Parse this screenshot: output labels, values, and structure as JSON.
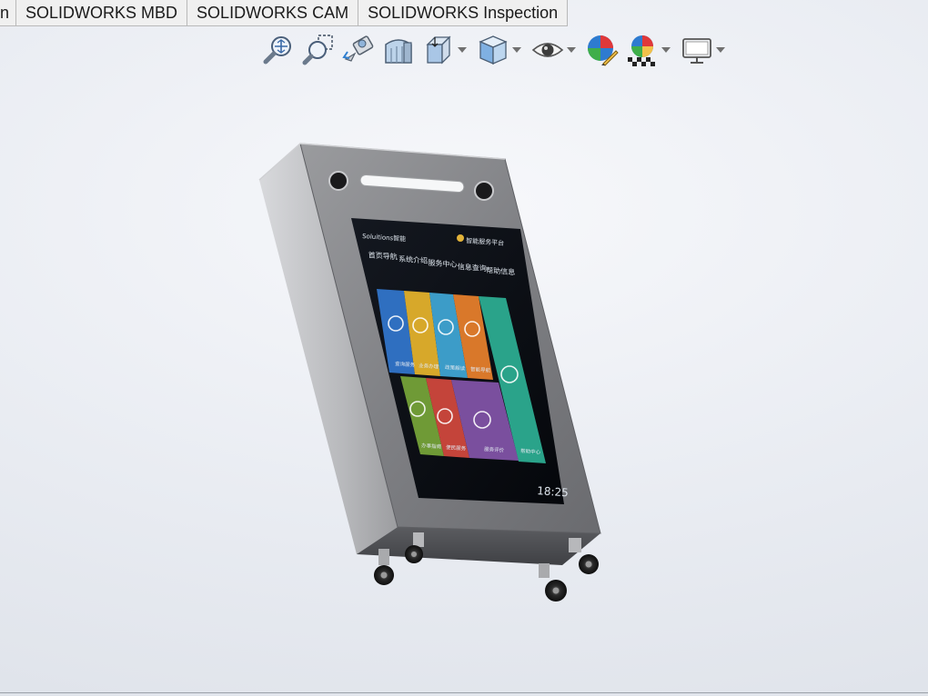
{
  "tabs": [
    {
      "label": "n"
    },
    {
      "label": "SOLIDWORKS MBD"
    },
    {
      "label": "SOLIDWORKS CAM"
    },
    {
      "label": "SOLIDWORKS Inspection"
    }
  ],
  "hud_toolbar": [
    {
      "name": "zoom-to-fit-icon"
    },
    {
      "name": "zoom-to-area-icon"
    },
    {
      "name": "previous-view-icon"
    },
    {
      "name": "section-view-icon"
    },
    {
      "name": "view-orientation-icon",
      "dropdown": true
    },
    {
      "name": "display-style-icon",
      "dropdown": true
    },
    {
      "name": "hide-show-items-icon",
      "dropdown": true
    },
    {
      "name": "edit-appearance-icon"
    },
    {
      "name": "apply-scene-icon",
      "dropdown": true
    },
    {
      "name": "view-settings-icon",
      "dropdown": true
    }
  ],
  "model": {
    "screen_header_left": "Soluitions智能",
    "screen_header_right": "智能服务平台",
    "menu": [
      "首页导航",
      "系统介绍",
      "服务中心",
      "信息查询",
      "帮助信息"
    ],
    "tiles": [
      "查询服务",
      "业务办理",
      "政策解读",
      "智能导航",
      "帮助中心",
      "办事指南",
      "便民服务",
      "服务评价"
    ],
    "clock": "18:25"
  },
  "colors": {
    "tab_bg": "#f0f0f0",
    "viewport_bg": "#eef0f4",
    "steel": "#8c8d90",
    "tile_blue": "#2f6fc0",
    "tile_yellow": "#d7a82a",
    "tile_cyan": "#3c9cc8",
    "tile_orange": "#d9782a",
    "tile_teal": "#2aa38a",
    "tile_green": "#6f9a36",
    "tile_red": "#c4443a",
    "tile_purple": "#7a4f9e"
  }
}
